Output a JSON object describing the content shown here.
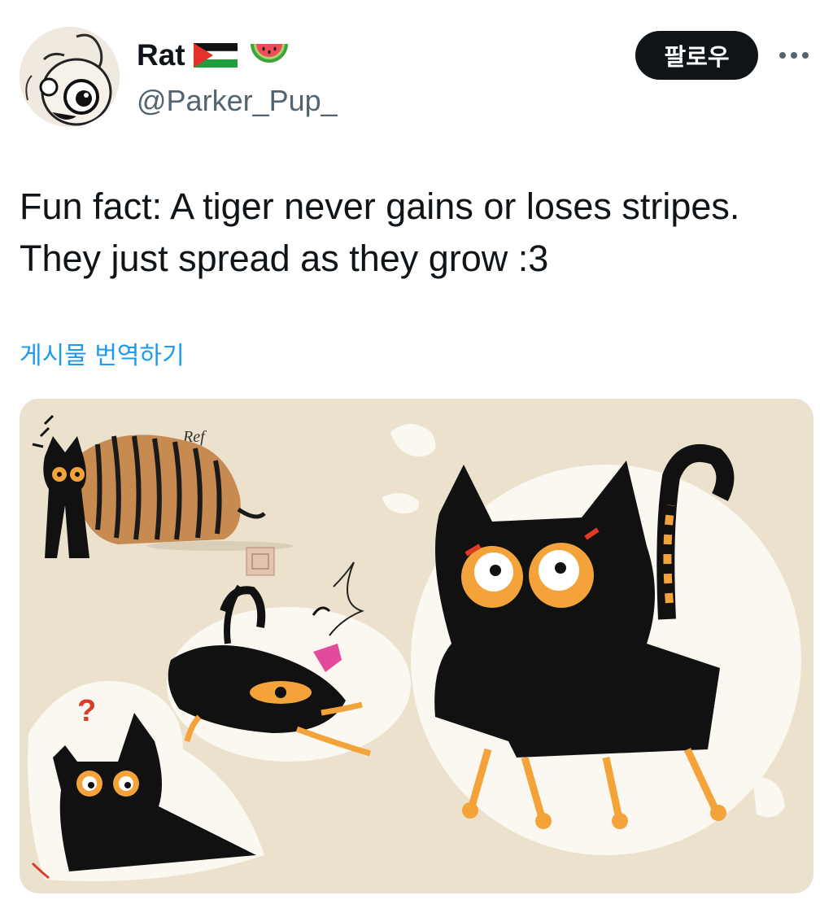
{
  "author": {
    "display_name": "Rat",
    "handle": "@Parker_Pup_",
    "avatar_icon": "cartoon-rat-avatar",
    "badges": [
      "palestine-flag-icon",
      "watermelon-icon"
    ]
  },
  "actions": {
    "follow_label": "팔로우",
    "more_icon": "more-dots-icon"
  },
  "tweet": {
    "line1": "Fun fact: A tiger never gains or loses stripes.",
    "line2": "They just spread as they grow :3",
    "translate_label": "게시물 번역하기"
  },
  "media": {
    "ref_label": "Ref",
    "question_mark": "?"
  },
  "colors": {
    "text_primary": "#0f1419",
    "text_secondary": "#536471",
    "link": "#1d9bf0",
    "button_bg": "#0f1419",
    "media_bg": "#ebe1cc"
  }
}
